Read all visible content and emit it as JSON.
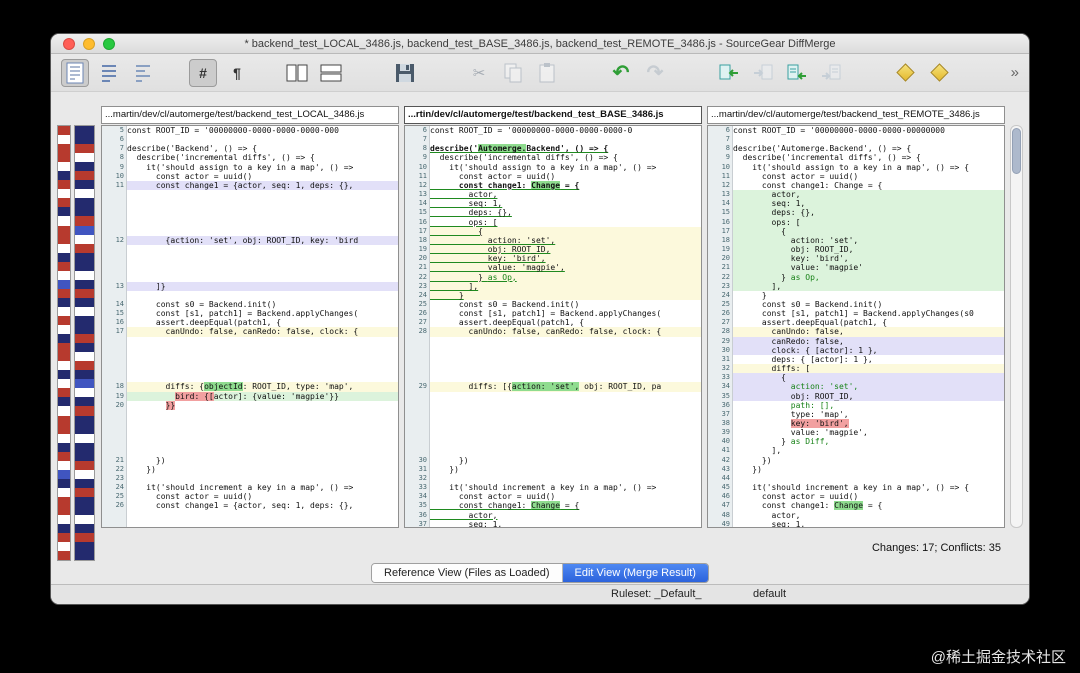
{
  "window": {
    "title": "* backend_test_LOCAL_3486.js, backend_test_BASE_3486.js, backend_test_REMOTE_3486.js - SourceGear DiffMerge"
  },
  "toolbar": {
    "hash_label": "#",
    "pilcrow_label": "¶",
    "icons": {
      "cut": "✂",
      "undo": "↶",
      "redo": "↷",
      "overflow": "»"
    }
  },
  "headers": {
    "local": "...martin/dev/cl/automerge/test/backend_test_LOCAL_3486.js",
    "base": "...rtin/dev/cl/automerge/test/backend_test_BASE_3486.js",
    "remote": "...martin/dev/cl/automerge/test/backend_test_REMOTE_3486.js"
  },
  "footer": {
    "changes_summary": "Changes: 17; Conflicts: 35",
    "reference_view_label": "Reference View (Files as Loaded)",
    "edit_view_label": "Edit View (Merge Result)",
    "ruleset_label": "Ruleset: _Default_",
    "ruleset_value": "default"
  },
  "watermark": "@稀土掘金技术社区",
  "colors": {
    "insert_row_bg": "#dcf3dc",
    "change_row_bg": "#fcf9dc",
    "conflict_row_bg": "#e2e0f8",
    "delete_highlight": "#f2a0a0",
    "insert_highlight": "#8fdc8f",
    "accent_blue": "#2c63dc"
  },
  "minimap": {
    "col1": [
      "#b73a2e",
      "#ffffff",
      "#b73a2e",
      "#b73a2e",
      "#ffffff",
      "#232a6e",
      "#b73a2e",
      "#ffffff",
      "#b73a2e",
      "#232a6e",
      "#ffffff",
      "#b73a2e",
      "#b73a2e",
      "#ffffff",
      "#232a6e",
      "#b73a2e",
      "#ffffff",
      "#4055c0",
      "#b73a2e",
      "#232a6e",
      "#ffffff",
      "#b73a2e",
      "#ffffff",
      "#232a6e",
      "#b73a2e",
      "#b73a2e",
      "#ffffff",
      "#232a6e",
      "#ffffff",
      "#b73a2e",
      "#232a6e",
      "#ffffff",
      "#b73a2e",
      "#b73a2e",
      "#ffffff",
      "#232a6e",
      "#b73a2e",
      "#ffffff",
      "#4055c0",
      "#232a6e",
      "#ffffff",
      "#b73a2e",
      "#b73a2e",
      "#ffffff",
      "#232a6e",
      "#b73a2e",
      "#ffffff",
      "#b73a2e"
    ],
    "col2": [
      "#232a6e",
      "#232a6e",
      "#b73a2e",
      "#ffffff",
      "#232a6e",
      "#b73a2e",
      "#232a6e",
      "#ffffff",
      "#232a6e",
      "#232a6e",
      "#b73a2e",
      "#4055c0",
      "#ffffff",
      "#b73a2e",
      "#232a6e",
      "#232a6e",
      "#ffffff",
      "#232a6e",
      "#b73a2e",
      "#232a6e",
      "#ffffff",
      "#232a6e",
      "#232a6e",
      "#b73a2e",
      "#232a6e",
      "#ffffff",
      "#b73a2e",
      "#232a6e",
      "#4055c0",
      "#ffffff",
      "#232a6e",
      "#b73a2e",
      "#232a6e",
      "#232a6e",
      "#ffffff",
      "#232a6e",
      "#232a6e",
      "#b73a2e",
      "#ffffff",
      "#232a6e",
      "#b73a2e",
      "#232a6e",
      "#232a6e",
      "#ffffff",
      "#232a6e",
      "#b73a2e",
      "#232a6e",
      "#232a6e"
    ]
  },
  "rows": [
    {
      "l": {
        "n": 5,
        "s": [
          [
            "const ROOT_ID = '00000000-0000-0000-0000-000"
          ]
        ]
      },
      "b": {
        "n": 6,
        "s": [
          [
            "const ROOT_ID = '00000000-0000-0000-0000-0"
          ]
        ]
      },
      "r": {
        "n": 6,
        "s": [
          [
            "const ROOT_ID = '00000000-0000-0000-00000000"
          ]
        ]
      }
    },
    {
      "l": {
        "n": 6,
        "s": []
      },
      "b": {
        "n": 7,
        "s": []
      },
      "r": {
        "n": 7,
        "s": []
      }
    },
    {
      "l": {
        "n": 7,
        "s": [
          [
            "describe('Backend', () => {"
          ]
        ]
      },
      "b": {
        "n": 8,
        "s": [
          [
            "describe('",
            "un b"
          ],
          [
            "Automerge.",
            "un b gh"
          ],
          [
            "Backend', () => {",
            "un b"
          ]
        ]
      },
      "r": {
        "n": 8,
        "s": [
          [
            "describe('Automerge.Backend', () => {"
          ]
        ]
      }
    },
    {
      "l": {
        "n": 8,
        "s": [
          [
            "  describe('incremental diffs', () => {"
          ]
        ]
      },
      "b": {
        "n": 9,
        "s": [
          [
            "  describe('incremental diffs', () => {"
          ]
        ]
      },
      "r": {
        "n": 9,
        "s": [
          [
            "  describe('incremental diffs', () => {"
          ]
        ]
      }
    },
    {
      "l": {
        "n": 9,
        "s": [
          [
            "    it('should assign to a key in a map', () =>"
          ]
        ]
      },
      "b": {
        "n": 10,
        "s": [
          [
            "    it('should assign to a key in a map', () =>"
          ]
        ]
      },
      "r": {
        "n": 10,
        "s": [
          [
            "    it('should assign to a key in a map', () => {"
          ]
        ]
      }
    },
    {
      "l": {
        "n": 10,
        "s": [
          [
            "      const actor = uuid()"
          ]
        ]
      },
      "b": {
        "n": 11,
        "s": [
          [
            "      const actor = uuid()"
          ]
        ]
      },
      "r": {
        "n": 11,
        "s": [
          [
            "      const actor = uuid()"
          ]
        ]
      }
    },
    {
      "l": {
        "n": 11,
        "bg": "lav",
        "s": [
          [
            "      const change1 = {actor, seq: 1, deps: {},"
          ]
        ]
      },
      "b": {
        "n": 12,
        "s": [
          [
            "      const change1: ",
            "un b"
          ],
          [
            "Change",
            "un b gh"
          ],
          [
            " = {",
            "un b"
          ]
        ]
      },
      "r": {
        "n": 12,
        "s": [
          [
            "      const change1: Change = {"
          ]
        ]
      }
    },
    {
      "l": null,
      "b": {
        "n": 13,
        "s": [
          [
            "        actor,",
            "un"
          ]
        ]
      },
      "r": {
        "n": 13,
        "bg": "grn",
        "s": [
          [
            "        actor,"
          ]
        ]
      }
    },
    {
      "l": null,
      "b": {
        "n": 14,
        "s": [
          [
            "        seq: 1,",
            "un"
          ]
        ]
      },
      "r": {
        "n": 14,
        "bg": "grn",
        "s": [
          [
            "        seq: 1,"
          ]
        ]
      }
    },
    {
      "l": null,
      "b": {
        "n": 15,
        "s": [
          [
            "        deps: {},",
            "un"
          ]
        ]
      },
      "r": {
        "n": 15,
        "bg": "grn",
        "s": [
          [
            "        deps: {},"
          ]
        ]
      }
    },
    {
      "l": null,
      "b": {
        "n": 16,
        "s": [
          [
            "        ops: [",
            "un"
          ]
        ]
      },
      "r": {
        "n": 16,
        "bg": "grn",
        "s": [
          [
            "        ops: ["
          ]
        ]
      }
    },
    {
      "l": null,
      "b": {
        "n": 17,
        "bg": "yel",
        "s": [
          [
            "          {",
            "un"
          ]
        ]
      },
      "r": {
        "n": 17,
        "bg": "grn",
        "s": [
          [
            "          {"
          ]
        ]
      }
    },
    {
      "l": {
        "n": 12,
        "bg": "lav",
        "s": [
          [
            "        {action: 'set', obj: ROOT_ID, key: 'bird"
          ]
        ]
      },
      "b": {
        "n": 18,
        "bg": "yel",
        "s": [
          [
            "            action: 'set',",
            "un"
          ]
        ]
      },
      "r": {
        "n": 18,
        "bg": "grn",
        "s": [
          [
            "            action: 'set',"
          ]
        ]
      }
    },
    {
      "l": null,
      "b": {
        "n": 19,
        "bg": "yel",
        "s": [
          [
            "            obj: ROOT_ID,",
            "un"
          ]
        ]
      },
      "r": {
        "n": 19,
        "bg": "grn",
        "s": [
          [
            "            obj: ROOT_ID,"
          ]
        ]
      }
    },
    {
      "l": null,
      "b": {
        "n": 20,
        "bg": "yel",
        "s": [
          [
            "            key: 'bird',",
            "un"
          ]
        ]
      },
      "r": {
        "n": 20,
        "bg": "grn",
        "s": [
          [
            "            key: 'bird',"
          ]
        ]
      }
    },
    {
      "l": null,
      "b": {
        "n": 21,
        "bg": "yel",
        "s": [
          [
            "            value: 'magpie',",
            "un"
          ]
        ]
      },
      "r": {
        "n": 21,
        "bg": "grn",
        "s": [
          [
            "            value: 'magpie'"
          ]
        ]
      }
    },
    {
      "l": null,
      "b": {
        "n": 22,
        "bg": "yel",
        "s": [
          [
            "          } ",
            "un"
          ],
          [
            "as Op,",
            "un gt"
          ]
        ]
      },
      "r": {
        "n": 22,
        "bg": "grn",
        "s": [
          [
            "          } "
          ],
          [
            "as Op,",
            "gt"
          ]
        ]
      }
    },
    {
      "l": {
        "n": 13,
        "bg": "lav",
        "s": [
          [
            "      ]}"
          ]
        ]
      },
      "b": {
        "n": 23,
        "bg": "yel",
        "s": [
          [
            "        ],",
            "un"
          ]
        ]
      },
      "r": {
        "n": 23,
        "bg": "grn",
        "s": [
          [
            "        ],"
          ]
        ]
      }
    },
    {
      "l": null,
      "b": {
        "n": 24,
        "bg": "yel",
        "s": [
          [
            "      }",
            "un"
          ]
        ]
      },
      "r": {
        "n": 24,
        "s": [
          [
            "      }"
          ]
        ]
      }
    },
    {
      "l": {
        "n": 14,
        "s": [
          [
            "      const s0 = Backend.init()"
          ]
        ]
      },
      "b": {
        "n": 25,
        "s": [
          [
            "      const s0 = Backend.init()"
          ]
        ]
      },
      "r": {
        "n": 25,
        "s": [
          [
            "      const s0 = Backend.init()"
          ]
        ]
      }
    },
    {
      "l": {
        "n": 15,
        "s": [
          [
            "      const [s1, patch1] = Backend.applyChanges("
          ]
        ]
      },
      "b": {
        "n": 26,
        "s": [
          [
            "      const [s1, patch1] = Backend.applyChanges("
          ]
        ]
      },
      "r": {
        "n": 26,
        "s": [
          [
            "      const [s1, patch1] = Backend.applyChanges(s0"
          ]
        ]
      }
    },
    {
      "l": {
        "n": 16,
        "s": [
          [
            "      assert.deepEqual(patch1, {"
          ]
        ]
      },
      "b": {
        "n": 27,
        "s": [
          [
            "      assert.deepEqual(patch1, {"
          ]
        ]
      },
      "r": {
        "n": 27,
        "s": [
          [
            "      assert.deepEqual(patch1, {"
          ]
        ]
      }
    },
    {
      "l": {
        "n": 17,
        "bg": "yel",
        "s": [
          [
            "        canUndo: false, canRedo: false, clock: {"
          ]
        ]
      },
      "b": {
        "n": 28,
        "bg": "yel",
        "s": [
          [
            "        canUndo: false, canRedo: false, clock: {"
          ]
        ]
      },
      "r": {
        "n": 28,
        "bg": "yel",
        "s": [
          [
            "        canUndo: false,"
          ]
        ]
      }
    },
    {
      "l": null,
      "b": null,
      "r": {
        "n": 29,
        "bg": "lav",
        "s": [
          [
            "        canRedo: false,"
          ]
        ]
      }
    },
    {
      "l": null,
      "b": null,
      "r": {
        "n": 30,
        "bg": "lav",
        "s": [
          [
            "        clock: { [actor]: 1 },"
          ]
        ]
      }
    },
    {
      "l": null,
      "b": null,
      "r": {
        "n": 31,
        "s": [
          [
            "        deps: { [actor]: 1 },"
          ]
        ]
      }
    },
    {
      "l": null,
      "b": null,
      "r": {
        "n": 32,
        "bg": "yel",
        "s": [
          [
            "        diffs: ["
          ]
        ]
      }
    },
    {
      "l": null,
      "b": null,
      "r": {
        "n": 33,
        "bg": "lav",
        "s": [
          [
            "          {"
          ]
        ]
      }
    },
    {
      "l": {
        "n": 18,
        "bg": "yel",
        "s": [
          [
            "        diffs: {"
          ],
          [
            "objectId",
            "gh"
          ],
          [
            ": ROOT_ID, type: 'map',"
          ]
        ]
      },
      "b": {
        "n": 29,
        "bg": "yel",
        "s": [
          [
            "        diffs: [{"
          ],
          [
            "action: 'set',",
            "gh"
          ],
          [
            " obj: ROOT_ID, pa"
          ]
        ]
      },
      "r": {
        "n": 34,
        "bg": "lav",
        "s": [
          [
            "            action: 'set',",
            "gt"
          ]
        ]
      }
    },
    {
      "l": {
        "n": 19,
        "bg": "grn",
        "s": [
          [
            "          "
          ],
          [
            "bird: {[",
            "ph"
          ],
          [
            "actor]: {value: 'magpie'}}"
          ]
        ]
      },
      "b": null,
      "r": {
        "n": 35,
        "bg": "lav",
        "s": [
          [
            "            obj: ROOT_ID,"
          ]
        ]
      }
    },
    {
      "l": {
        "n": 20,
        "s": [
          [
            "        "
          ],
          [
            "}}",
            "ph"
          ]
        ]
      },
      "b": null,
      "r": {
        "n": 36,
        "s": [
          [
            "            path: [],",
            "gt"
          ]
        ]
      }
    },
    {
      "l": null,
      "b": null,
      "r": {
        "n": 37,
        "s": [
          [
            "            type: 'map',"
          ]
        ]
      }
    },
    {
      "l": null,
      "b": null,
      "r": {
        "n": 38,
        "s": [
          [
            "            "
          ],
          [
            "key: 'bird',",
            "ph"
          ]
        ]
      }
    },
    {
      "l": null,
      "b": null,
      "r": {
        "n": 39,
        "s": [
          [
            "            value: 'magpie',"
          ]
        ]
      }
    },
    {
      "l": null,
      "b": null,
      "r": {
        "n": 40,
        "s": [
          [
            "          } "
          ],
          [
            "as Diff,",
            "gt"
          ]
        ]
      }
    },
    {
      "l": null,
      "b": null,
      "r": {
        "n": 41,
        "s": [
          [
            "        ],"
          ]
        ]
      }
    },
    {
      "l": {
        "n": 21,
        "s": [
          [
            "      })"
          ]
        ]
      },
      "b": {
        "n": 30,
        "s": [
          [
            "      })"
          ]
        ]
      },
      "r": {
        "n": 42,
        "s": [
          [
            "      })"
          ]
        ]
      }
    },
    {
      "l": {
        "n": 22,
        "s": [
          [
            "    })"
          ]
        ]
      },
      "b": {
        "n": 31,
        "s": [
          [
            "    })"
          ]
        ]
      },
      "r": {
        "n": 43,
        "s": [
          [
            "    })"
          ]
        ]
      }
    },
    {
      "l": {
        "n": 23,
        "s": []
      },
      "b": {
        "n": 32,
        "s": []
      },
      "r": {
        "n": 44,
        "s": []
      }
    },
    {
      "l": {
        "n": 24,
        "s": [
          [
            "    it('should increment a key in a map', () =>"
          ]
        ]
      },
      "b": {
        "n": 33,
        "s": [
          [
            "    it('should increment a key in a map', () =>"
          ]
        ]
      },
      "r": {
        "n": 45,
        "s": [
          [
            "    it('should increment a key in a map', () => {"
          ]
        ]
      }
    },
    {
      "l": {
        "n": 25,
        "s": [
          [
            "      const actor = uuid()"
          ]
        ]
      },
      "b": {
        "n": 34,
        "s": [
          [
            "      const actor = uuid()"
          ]
        ]
      },
      "r": {
        "n": 46,
        "s": [
          [
            "      const actor = uuid()"
          ]
        ]
      }
    },
    {
      "l": {
        "n": 26,
        "s": [
          [
            "      const change1 = {actor, seq: 1, deps: {},"
          ]
        ]
      },
      "b": {
        "n": 35,
        "s": [
          [
            "      const change1: ",
            "un"
          ],
          [
            "Change",
            "un gh"
          ],
          [
            " = {",
            "un"
          ]
        ]
      },
      "r": {
        "n": 47,
        "s": [
          [
            "      const change1: "
          ],
          [
            "Change",
            "gh"
          ],
          [
            " = {"
          ]
        ]
      }
    },
    {
      "l": null,
      "b": {
        "n": 36,
        "s": [
          [
            "        actor,",
            "un"
          ]
        ]
      },
      "r": {
        "n": 48,
        "s": [
          [
            "        actor,"
          ]
        ]
      }
    },
    {
      "l": null,
      "b": {
        "n": 37,
        "s": [
          [
            "        seq: 1,",
            "un"
          ]
        ]
      },
      "r": {
        "n": 49,
        "s": [
          [
            "        seq: 1,"
          ]
        ]
      }
    }
  ]
}
